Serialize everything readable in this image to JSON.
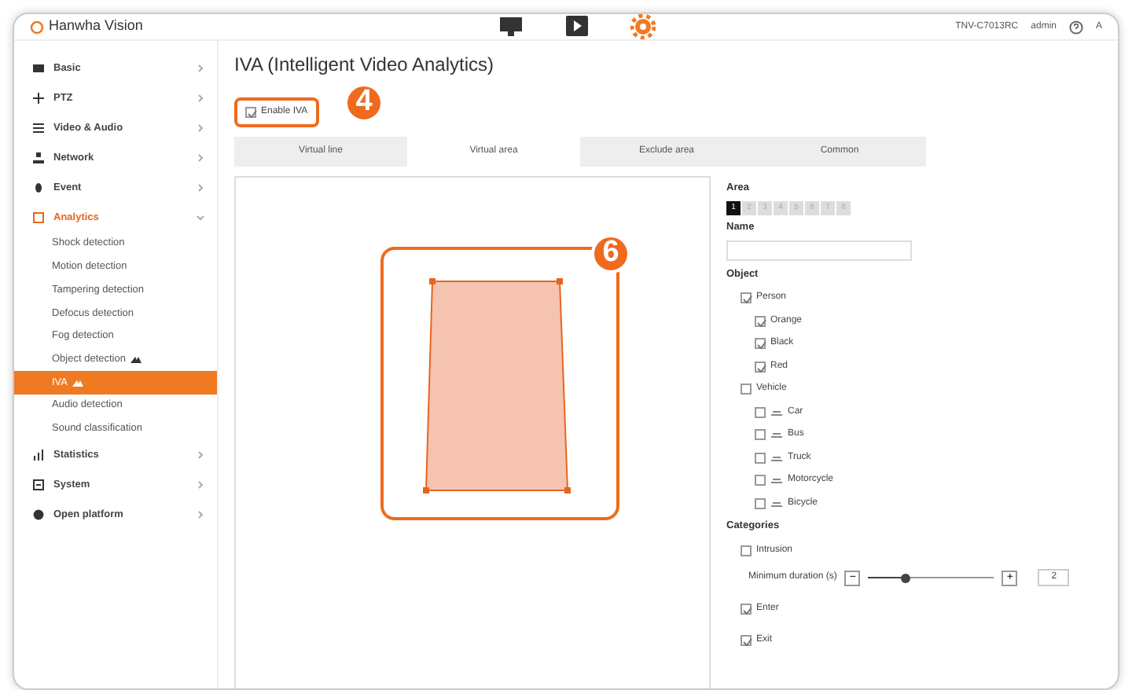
{
  "topbar": {
    "logo": "Hanwha Vision",
    "nav": [
      {
        "selected": false
      },
      {
        "selected": false
      },
      {
        "selected": true
      }
    ],
    "model": "TNV-C7013RC",
    "user": "admin",
    "cut_label": "A"
  },
  "sidebar": {
    "items": [
      {
        "label": "Basic",
        "expanded": false
      },
      {
        "label": "PTZ",
        "expanded": false
      },
      {
        "label": "Video & Audio",
        "expanded": false
      },
      {
        "label": "Network",
        "expanded": false
      },
      {
        "label": "Event",
        "expanded": false
      },
      {
        "label": "Analytics",
        "expanded": true,
        "children": [
          {
            "label": "Shock detection",
            "selected": false,
            "ai": false
          },
          {
            "label": "Motion detection",
            "selected": false,
            "ai": false
          },
          {
            "label": "Tampering detection",
            "selected": false,
            "ai": false
          },
          {
            "label": "Defocus detection",
            "selected": false,
            "ai": false
          },
          {
            "label": "Fog detection",
            "selected": false,
            "ai": false
          },
          {
            "label": "Object detection",
            "selected": false,
            "ai": true
          },
          {
            "label": "IVA",
            "selected": true,
            "ai": true
          },
          {
            "label": "Audio detection",
            "selected": false,
            "ai": false
          },
          {
            "label": "Sound classification",
            "selected": false,
            "ai": false
          }
        ]
      },
      {
        "label": "Statistics",
        "expanded": false
      },
      {
        "label": "System",
        "expanded": false
      },
      {
        "label": "Open platform",
        "expanded": false
      }
    ]
  },
  "page": {
    "title": "IVA (Intelligent Video Analytics)",
    "enable": {
      "label": "Enable IVA",
      "checked": true
    },
    "tabs": [
      {
        "label": "Virtual line",
        "selected": false
      },
      {
        "label": "Virtual area",
        "selected": true
      },
      {
        "label": "Exclude area",
        "selected": false
      },
      {
        "label": "Common",
        "selected": false
      }
    ]
  },
  "settings": {
    "area_label": "Area",
    "areas": [
      {
        "label": "1",
        "selected": true
      },
      {
        "label": "2",
        "selected": false
      },
      {
        "label": "3",
        "selected": false
      },
      {
        "label": "4",
        "selected": false
      },
      {
        "label": "5",
        "selected": false
      },
      {
        "label": "6",
        "selected": false
      },
      {
        "label": "7",
        "selected": false
      },
      {
        "label": "8",
        "selected": false
      }
    ],
    "name_label": "Name",
    "object_label": "Object",
    "objects": [
      {
        "label": "Person",
        "checked": true,
        "children": [
          {
            "label": "Orange",
            "checked": true
          },
          {
            "label": "Black",
            "checked": true
          },
          {
            "label": "Red",
            "checked": true
          }
        ]
      },
      {
        "label": "Vehicle",
        "checked": false,
        "children": [
          {
            "label": "Car",
            "checked": false
          },
          {
            "label": "Bus",
            "checked": false
          },
          {
            "label": "Truck",
            "checked": false
          },
          {
            "label": "Motorcycle",
            "checked": false
          },
          {
            "label": "Bicycle",
            "checked": false
          }
        ]
      }
    ],
    "categories_label": "Categories",
    "intrusion": {
      "label": "Intrusion",
      "checked": false
    },
    "duration": {
      "label": "Minimum duration (s)",
      "minus": "−",
      "plus": "+",
      "level": 0.3,
      "value": "2"
    },
    "events": [
      {
        "label": "Enter",
        "checked": true
      },
      {
        "label": "Exit",
        "checked": true
      }
    ]
  },
  "callouts": [
    {
      "number": "4"
    },
    {
      "number": "6"
    }
  ]
}
